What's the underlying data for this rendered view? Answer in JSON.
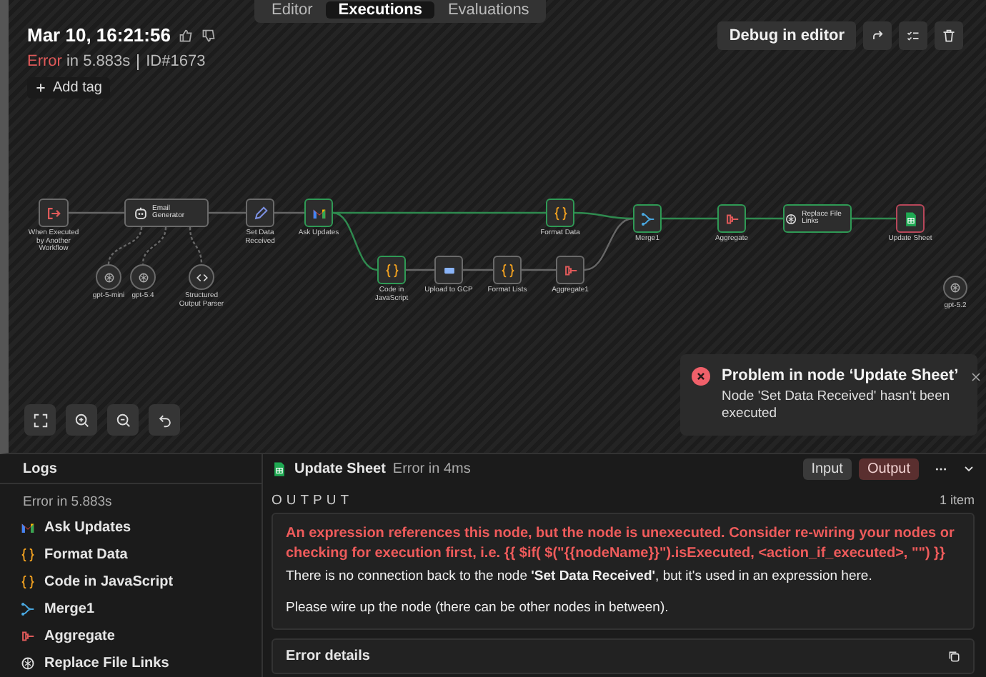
{
  "view_tabs": [
    {
      "label": "Editor",
      "selected": false
    },
    {
      "label": "Executions",
      "selected": true
    },
    {
      "label": "Evaluations",
      "selected": false
    }
  ],
  "execution": {
    "date": "Mar 10, 16:21:56",
    "status": "Error",
    "duration": "in 5.883s",
    "id": "ID#1673",
    "add_tag": "Add tag"
  },
  "toolbar": {
    "debug_button": "Debug in editor"
  },
  "nodes": [
    {
      "name": "When Executed by Another Workflow",
      "kind": "trigger",
      "succeeded": false,
      "failed": false
    },
    {
      "name": "Email Generator",
      "kind": "agent",
      "succeeded": false,
      "failed": false
    },
    {
      "name": "Set Data Received",
      "kind": "set",
      "succeeded": false,
      "failed": false
    },
    {
      "name": "Ask Updates",
      "kind": "gmail",
      "succeeded": true,
      "failed": false
    },
    {
      "name": "Format Data",
      "kind": "code",
      "succeeded": true,
      "failed": false
    },
    {
      "name": "Merge1",
      "kind": "merge",
      "succeeded": true,
      "failed": false
    },
    {
      "name": "Aggregate",
      "kind": "aggregate",
      "succeeded": true,
      "failed": false
    },
    {
      "name": "Replace File Links",
      "kind": "openai",
      "succeeded": true,
      "failed": false
    },
    {
      "name": "Update Sheet",
      "kind": "sheet",
      "succeeded": false,
      "failed": true
    },
    {
      "name": "gpt-5-mini",
      "kind": "model",
      "succeeded": false,
      "failed": false
    },
    {
      "name": "gpt-5.4",
      "kind": "model",
      "succeeded": false,
      "failed": false
    },
    {
      "name": "Structured Output Parser",
      "kind": "parser",
      "succeeded": false,
      "failed": false
    },
    {
      "name": "Code in JavaScript",
      "kind": "code",
      "succeeded": true,
      "failed": false
    },
    {
      "name": "Upload to GCP",
      "kind": "upload",
      "succeeded": false,
      "failed": false
    },
    {
      "name": "Format Lists",
      "kind": "code",
      "succeeded": false,
      "failed": false
    },
    {
      "name": "Aggregate1",
      "kind": "aggregate",
      "succeeded": false,
      "failed": false
    },
    {
      "name": "gpt-5.2",
      "kind": "model",
      "succeeded": false,
      "failed": false
    }
  ],
  "toast": {
    "title": "Problem in node ‘Update Sheet’",
    "message": "Node 'Set Data Received' hasn't been executed"
  },
  "logs": {
    "title": "Logs",
    "summary": "Error in 5.883s",
    "items": [
      {
        "name": "Ask Updates",
        "kind": "gmail"
      },
      {
        "name": "Format Data",
        "kind": "code"
      },
      {
        "name": "Code in JavaScript",
        "kind": "code"
      },
      {
        "name": "Merge1",
        "kind": "merge"
      },
      {
        "name": "Aggregate",
        "kind": "aggregate"
      },
      {
        "name": "Replace File Links",
        "kind": "openai"
      }
    ]
  },
  "detail": {
    "node": "Update Sheet",
    "kind": "sheet",
    "status": "Error in 4ms",
    "tabs": [
      {
        "label": "Input",
        "selected": false
      },
      {
        "label": "Output",
        "selected": true
      }
    ],
    "section": "OUTPUT",
    "count": "1 item",
    "error": "An expression references this node, but the node is unexecuted. Consider re-wiring your nodes or checking for execution first, i.e. {{ $if( $(\"{{nodeName}}\").isExecuted, <action_if_executed>, \"\") }}",
    "description": "There is no connection back to the node **'Set Data Received'**, but it's used in an expression here.",
    "hint": "Please wire up the node (there can be other nodes in between).",
    "details_title": "Error details"
  }
}
